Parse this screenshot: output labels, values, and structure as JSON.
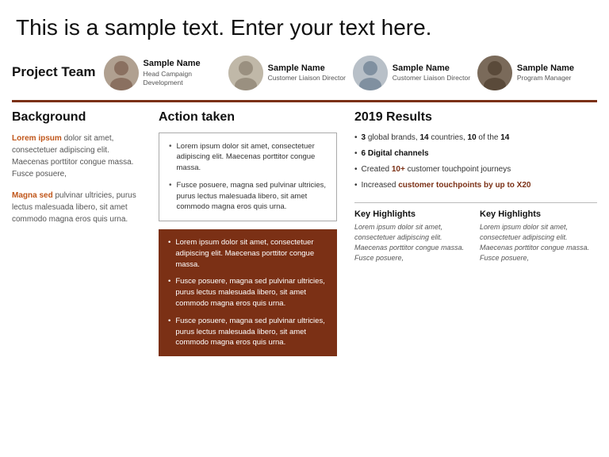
{
  "header": {
    "title": "This is a sample text. Enter your text here."
  },
  "team": {
    "label": "Project Team",
    "members": [
      {
        "name": "Sample Name",
        "role": "Head Campaign Development"
      },
      {
        "name": "Sample Name",
        "role": "Customer Liaison Director"
      },
      {
        "name": "Sample Name",
        "role": "Customer Liaison Director"
      },
      {
        "name": "Sample Name",
        "role": "Program Manager"
      }
    ]
  },
  "background": {
    "title": "Background",
    "paragraph1_prefix": " dolor sit amet, consectetuer adipiscing elit. Maecenas porttitor congue massa. Fusce posuere,",
    "highlight1": "Lorem ipsum",
    "paragraph2_prefix": " pulvinar ultricies, purus lectus malesuada libero, sit amet commodo magna eros quis urna.",
    "highlight2": "Magna sed"
  },
  "action": {
    "title": "Action taken",
    "white_items": [
      "Lorem ipsum dolor sit amet, consectetuer adipiscing elit. Maecenas porttitor congue massa.",
      "Fusce posuere, magna sed pulvinar ultricies, purus lectus malesuada libero, sit amet commodo magna eros quis urna."
    ],
    "brown_items": [
      "Lorem ipsum dolor sit amet, consectetuer adipiscing elit. Maecenas porttitor congue massa.",
      "Fusce posuere, magna sed pulvinar ultricies, purus lectus malesuada libero, sit amet commodo magna eros quis urna.",
      "Fusce posuere, magna sed pulvinar ultricies, purus lectus malesuada libero, sit amet commodo magna eros quis urna."
    ]
  },
  "results": {
    "title": "2019 Results",
    "items": [
      {
        "text": "3 global brands, 14 countries, 10 of the 14",
        "bold_parts": [
          "3",
          "14",
          "10"
        ]
      },
      {
        "text": "6 Digital channels",
        "bold": true
      },
      {
        "text": "Created 10+ customer touchpoint journeys"
      },
      {
        "text": "Increased customer touchpoints by up to X20"
      }
    ],
    "highlights": [
      {
        "title": "Key Highlights",
        "text": "Lorem ipsum dolor sit amet, consectetuer adipiscing elit. Maecenas porttitor congue massa. Fusce posuere,"
      },
      {
        "title": "Key Highlights",
        "text": "Lorem ipsum dolor sit amet, consectetuer adipiscing elit. Maecenas porttitor congue massa. Fusce posuere,"
      }
    ]
  }
}
